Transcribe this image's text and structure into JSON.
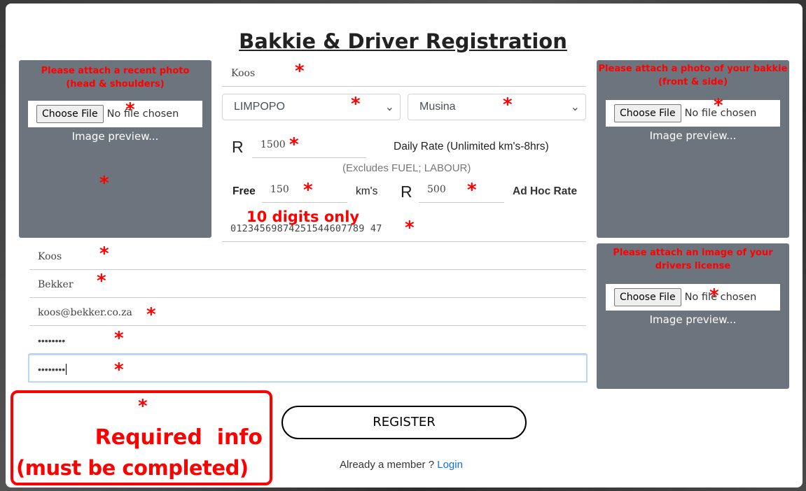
{
  "title": "Bakkie & Driver Registration",
  "photo_panel": {
    "title": "Please attach a recent photo (head & shoulders)",
    "choose": "Choose File",
    "status": "No file chosen",
    "preview": "Image preview..."
  },
  "bakkie_panel": {
    "title": "Please attach a photo of your bakkie (front & side)",
    "choose": "Choose File",
    "status": "No file chosen",
    "preview": "Image preview..."
  },
  "license_panel": {
    "title": "Please attach an image of your drivers license",
    "choose": "Choose File",
    "status": "No file chosen",
    "preview": "Image preview..."
  },
  "form": {
    "business_name": "Koos",
    "province": "LIMPOPO",
    "town": "Musina",
    "currency": "R",
    "daily_rate": "1500",
    "daily_rate_label": "Daily Rate (Unlimited km's-8hrs)",
    "excludes": "(Excludes FUEL; LABOUR)",
    "free_label": "Free",
    "free_km": "150",
    "km_label": "km's",
    "adhoc_rate": "500",
    "adhoc_label": "Ad Hoc Rate",
    "phone_hint": "10 digits only",
    "phone": "01234569874251544607789 47",
    "first_name": "Koos",
    "last_name": "Bekker",
    "email": "koos@bekker.co.za",
    "password": "••••••••",
    "confirm_password": "••••••••"
  },
  "required_note": {
    "star": "*",
    "line1": "Required  info",
    "line2": "(must be completed)"
  },
  "register": "REGISTER",
  "login_prompt": "Already a member ?",
  "login_link": "Login",
  "star": "*",
  "colors": {
    "panel": "#6c757d",
    "required": "#ff0000",
    "link": "#0d6efd"
  }
}
